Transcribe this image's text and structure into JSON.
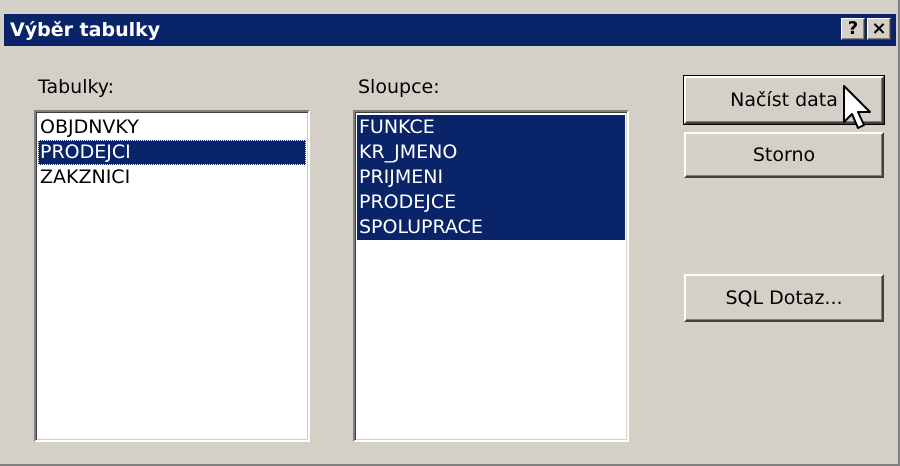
{
  "window": {
    "title": "Výběr tabulky",
    "help_label": "?",
    "close_label": "×"
  },
  "tables": {
    "label": "Tabulky:",
    "items": [
      "OBJDNVKY",
      "PRODEJCI",
      "ZAKZNICI"
    ],
    "selected": "PRODEJCI"
  },
  "columns": {
    "label": "Sloupce:",
    "items": [
      "FUNKCE",
      "KR_JMENO",
      "PRIJMENI",
      "PRODEJCE",
      "SPOLUPRACE"
    ],
    "selected_all": true
  },
  "buttons": {
    "load": "Načíst data",
    "cancel": "Storno",
    "sql": "SQL Dotaz..."
  },
  "colors": {
    "titlebar": "#0a246a",
    "face": "#d4d0c8",
    "selection": "#0a246a"
  },
  "icons": {
    "cursor": "arrow-cursor-icon"
  }
}
